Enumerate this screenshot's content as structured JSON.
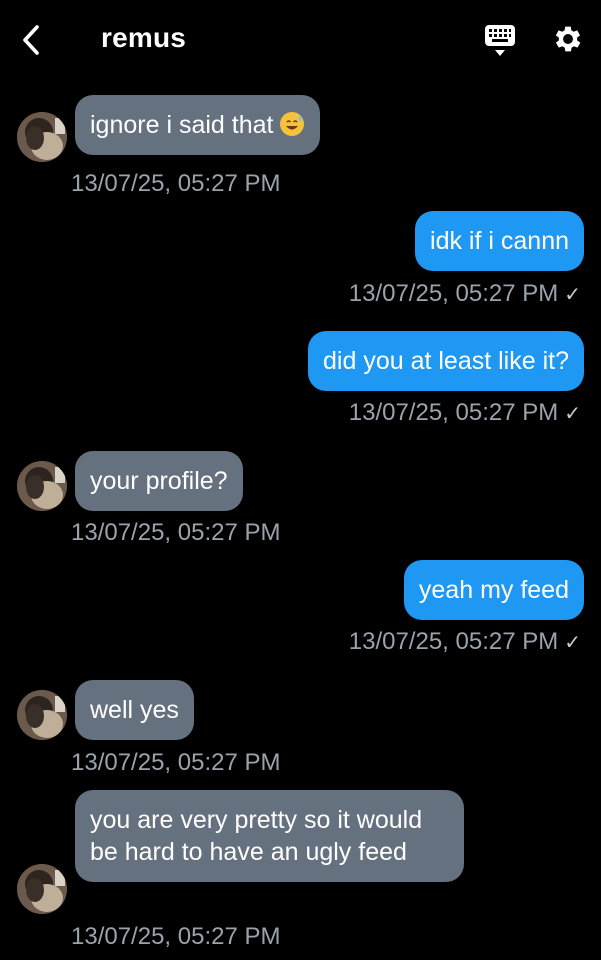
{
  "header": {
    "title": "remus",
    "back_icon": "chevron-left-icon",
    "keyboard_icon": "keyboard-icon",
    "settings_icon": "gear-icon"
  },
  "colors": {
    "background": "#000000",
    "incoming_bubble": "#65717f",
    "outgoing_bubble": "#1f98f3",
    "timestamp": "#9aa3ad"
  },
  "messages": [
    {
      "direction": "incoming",
      "text": "ignore i said that",
      "emoji": "sweat-smile-emoji",
      "timestamp": "13/07/25, 05:27 PM"
    },
    {
      "direction": "outgoing",
      "text": "idk if i cannn",
      "timestamp": "13/07/25, 05:27 PM",
      "read_mark": "✓"
    },
    {
      "direction": "outgoing",
      "text": "did you at least like it?",
      "timestamp": "13/07/25, 05:27 PM",
      "read_mark": "✓"
    },
    {
      "direction": "incoming",
      "text": "your profile?",
      "timestamp": "13/07/25, 05:27 PM"
    },
    {
      "direction": "outgoing",
      "text": "yeah my feed",
      "timestamp": "13/07/25, 05:27 PM",
      "read_mark": "✓"
    },
    {
      "direction": "incoming",
      "text": "well yes",
      "timestamp": "13/07/25, 05:27 PM"
    },
    {
      "direction": "incoming",
      "text": "you are very pretty so it would be hard to have an ugly feed",
      "timestamp": "13/07/25, 05:27 PM"
    }
  ]
}
